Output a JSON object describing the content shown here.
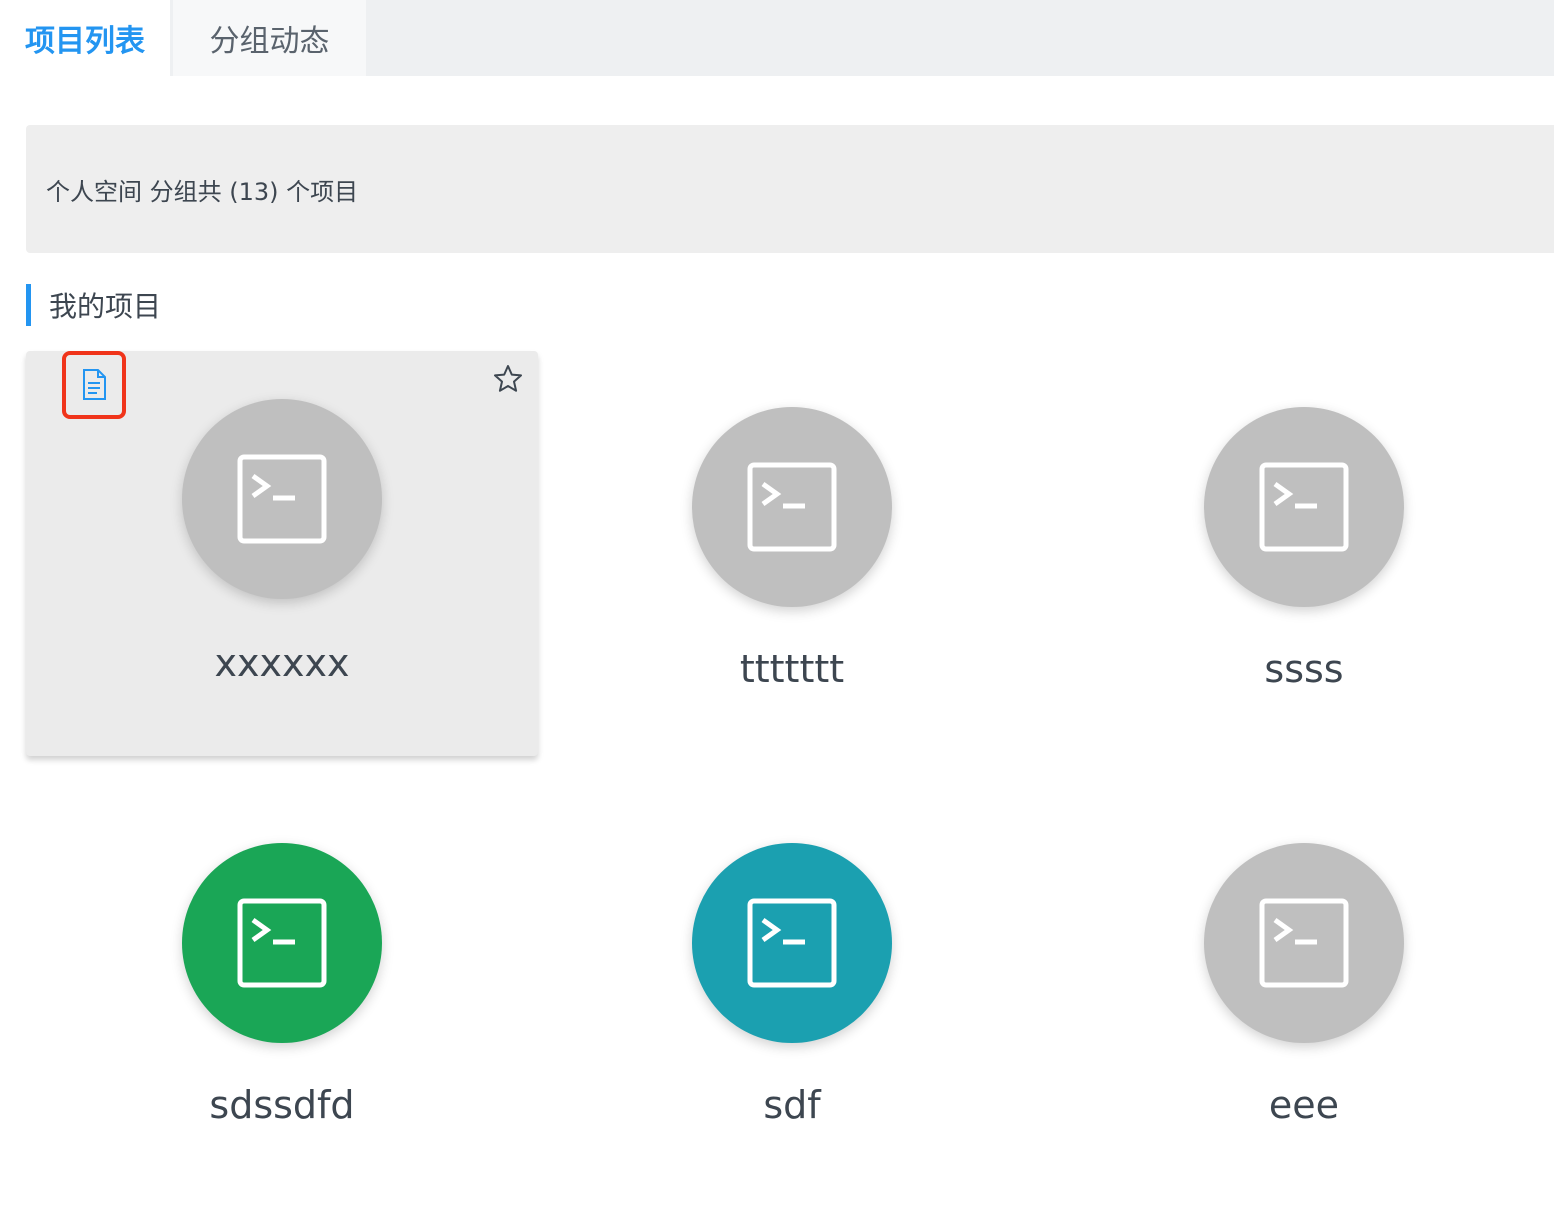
{
  "tabs": [
    {
      "label": "项目列表",
      "active": true
    },
    {
      "label": "分组动态",
      "active": false
    }
  ],
  "info_bar": {
    "text": "个人空间 分组共 (13) 个项目"
  },
  "section": {
    "title": "我的项目"
  },
  "projects": [
    {
      "name": "xxxxxx",
      "color": "#bfbfbf",
      "icon": "terminal-icon",
      "hovered": true
    },
    {
      "name": "ttttttt",
      "color": "#bfbfbf",
      "icon": "terminal-icon"
    },
    {
      "name": "ssss",
      "color": "#bfbfbf",
      "icon": "terminal-icon"
    },
    {
      "name": "sdssdfd",
      "color": "#1aa656",
      "icon": "terminal-icon"
    },
    {
      "name": "sdf",
      "color": "#1ba0b0",
      "icon": "terminal-icon"
    },
    {
      "name": "eee",
      "color": "#bfbfbf",
      "icon": "terminal-icon"
    }
  ],
  "colors": {
    "accent": "#2395f1",
    "highlight_border": "#f0341a"
  }
}
